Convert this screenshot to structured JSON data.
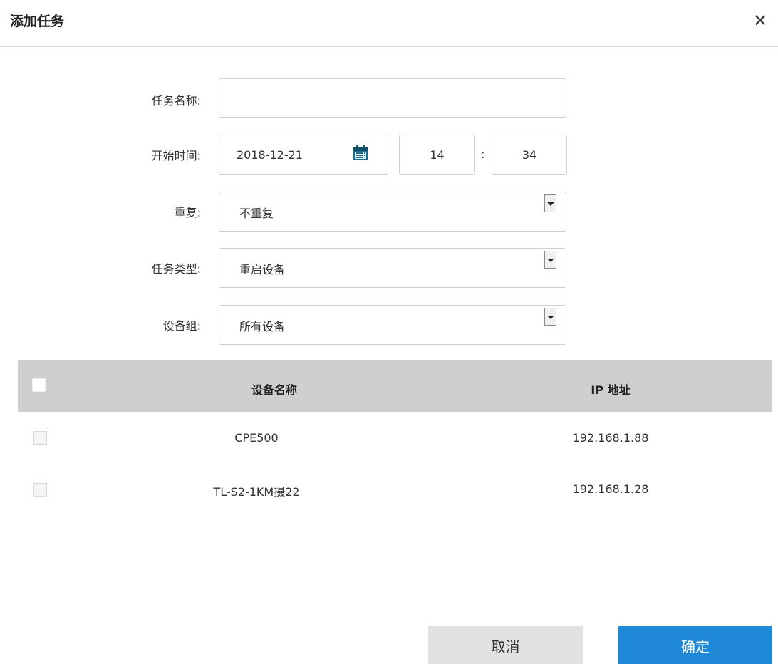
{
  "dialog": {
    "title": "添加任务",
    "close_glyph": "✕"
  },
  "form": {
    "task_name": {
      "label": "任务名称:",
      "value": ""
    },
    "start_time": {
      "label": "开始时间:",
      "date": "2018-12-21",
      "hour": "14",
      "separator": ":",
      "minute": "34"
    },
    "repeat": {
      "label": "重复:",
      "value": "不重复"
    },
    "task_type": {
      "label": "任务类型:",
      "value": "重启设备"
    },
    "device_group": {
      "label": "设备组:",
      "value": "所有设备"
    }
  },
  "table": {
    "headers": {
      "name": "设备名称",
      "ip": "IP 地址"
    },
    "rows": [
      {
        "name": "CPE500",
        "ip": "192.168.1.88"
      },
      {
        "name": "TL-S2-1KM摄22",
        "ip": "192.168.1.28"
      }
    ]
  },
  "buttons": {
    "cancel": "取消",
    "ok": "确定"
  },
  "colors": {
    "primary": "#1f89d8",
    "table_header": "#cfcfcf",
    "cancel_bg": "#e2e2e2",
    "calendar_icon": "#1a6e8e"
  },
  "icons": {
    "calendar": "calendar-icon",
    "dropdown": "chevron-down-icon",
    "close": "close-icon"
  }
}
